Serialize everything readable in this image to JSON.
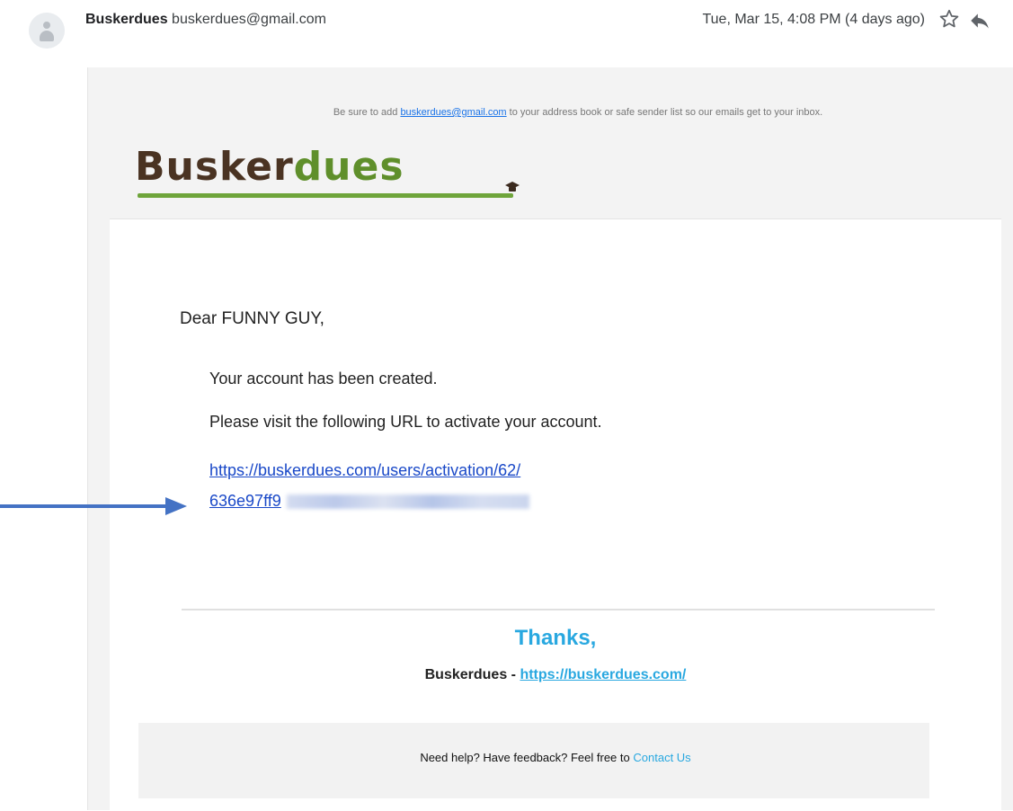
{
  "header": {
    "sender_name": "Buskerdues",
    "sender_email": "buskerdues@gmail.com",
    "date": "Tue, Mar 15, 4:08 PM (4 days ago)",
    "star_icon": "star-outline-icon",
    "reply_icon": "reply-icon"
  },
  "email": {
    "safe_sender_prefix": "Be sure to add",
    "safe_sender_link": "buskerdues@gmail.com",
    "safe_sender_suffix": "to your address book or safe sender list so our emails get to your inbox.",
    "logo_part1": "Busker",
    "logo_part2": "dues",
    "greeting": "Dear FUNNY GUY,",
    "line1": "Your account has been created.",
    "line2": "Please visit the following URL to activate your account.",
    "activation_link_line1": "https://buskerdues.com/users/activation/62/",
    "activation_link_line2": "636e97ff9",
    "thanks": "Thanks,",
    "signature_name": "Buskerdues -",
    "signature_link": "https://buskerdues.com/",
    "help_text": "Need help? Have feedback? Feel free to",
    "help_link": "Contact Us"
  },
  "colors": {
    "link_blue": "#1a49c8",
    "thanks_blue": "#29a8e0",
    "arrow_blue": "#4472c4",
    "logo_brown": "#4a3322",
    "logo_green": "#5f8f2b"
  }
}
